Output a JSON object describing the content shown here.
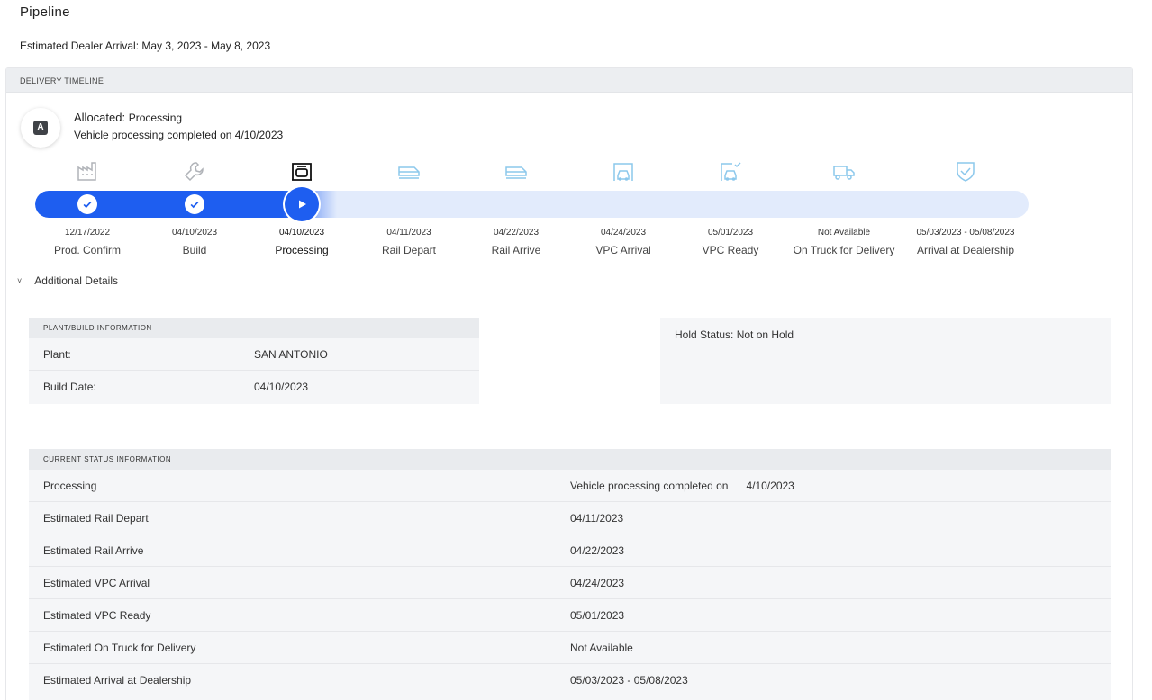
{
  "page": {
    "title": "Pipeline",
    "arrival_label": "Estimated Dealer Arrival: May 3, 2023 - May 8, 2023"
  },
  "timeline": {
    "header": "DELIVERY TIMELINE",
    "badge_letter": "A",
    "allocated_label": "Allocated:",
    "allocated_status": "Processing",
    "subtitle": "Vehicle processing completed on 4/10/2023",
    "progress_fraction": 0.3,
    "accent_color": "#1e5ef0",
    "stages": [
      {
        "date": "12/17/2022",
        "label": "Prod. Confirm",
        "icon": "factory-icon",
        "state": "done"
      },
      {
        "date": "04/10/2023",
        "label": "Build",
        "icon": "wrench-icon",
        "state": "done"
      },
      {
        "date": "04/10/2023",
        "label": "Processing",
        "icon": "garage-icon",
        "state": "current"
      },
      {
        "date": "04/11/2023",
        "label": "Rail Depart",
        "icon": "train-icon",
        "state": "pending"
      },
      {
        "date": "04/22/2023",
        "label": "Rail Arrive",
        "icon": "train-icon",
        "state": "pending"
      },
      {
        "date": "04/24/2023",
        "label": "VPC Arrival",
        "icon": "vpc-arrival-icon",
        "state": "pending"
      },
      {
        "date": "05/01/2023",
        "label": "VPC Ready",
        "icon": "vpc-ready-icon",
        "state": "pending"
      },
      {
        "date": "Not Available",
        "label": "On Truck for Delivery",
        "icon": "truck-icon",
        "state": "pending"
      },
      {
        "date": "05/03/2023 - 05/08/2023",
        "label": "Arrival at Dealership",
        "icon": "shield-check-icon",
        "state": "pending"
      }
    ]
  },
  "details": {
    "toggle_label": "Additional Details",
    "plant": {
      "header": "PLANT/BUILD INFORMATION",
      "rows": [
        {
          "label": "Plant:",
          "value": "SAN ANTONIO"
        },
        {
          "label": "Build Date:",
          "value": "04/10/2023"
        }
      ]
    },
    "hold_status": "Hold Status: Not on Hold",
    "current": {
      "header": "CURRENT STATUS INFORMATION",
      "rows": [
        {
          "label": "Processing",
          "value": "Vehicle processing completed on",
          "value2": "4/10/2023"
        },
        {
          "label": "Estimated Rail Depart",
          "value": "04/11/2023"
        },
        {
          "label": "Estimated Rail Arrive",
          "value": "04/22/2023"
        },
        {
          "label": "Estimated VPC Arrival",
          "value": "04/24/2023"
        },
        {
          "label": "Estimated VPC Ready",
          "value": "05/01/2023"
        },
        {
          "label": "Estimated On Truck for Delivery",
          "value": "Not Available"
        },
        {
          "label": "Estimated Arrival at Dealership",
          "value": "05/03/2023 - 05/08/2023"
        }
      ]
    }
  }
}
